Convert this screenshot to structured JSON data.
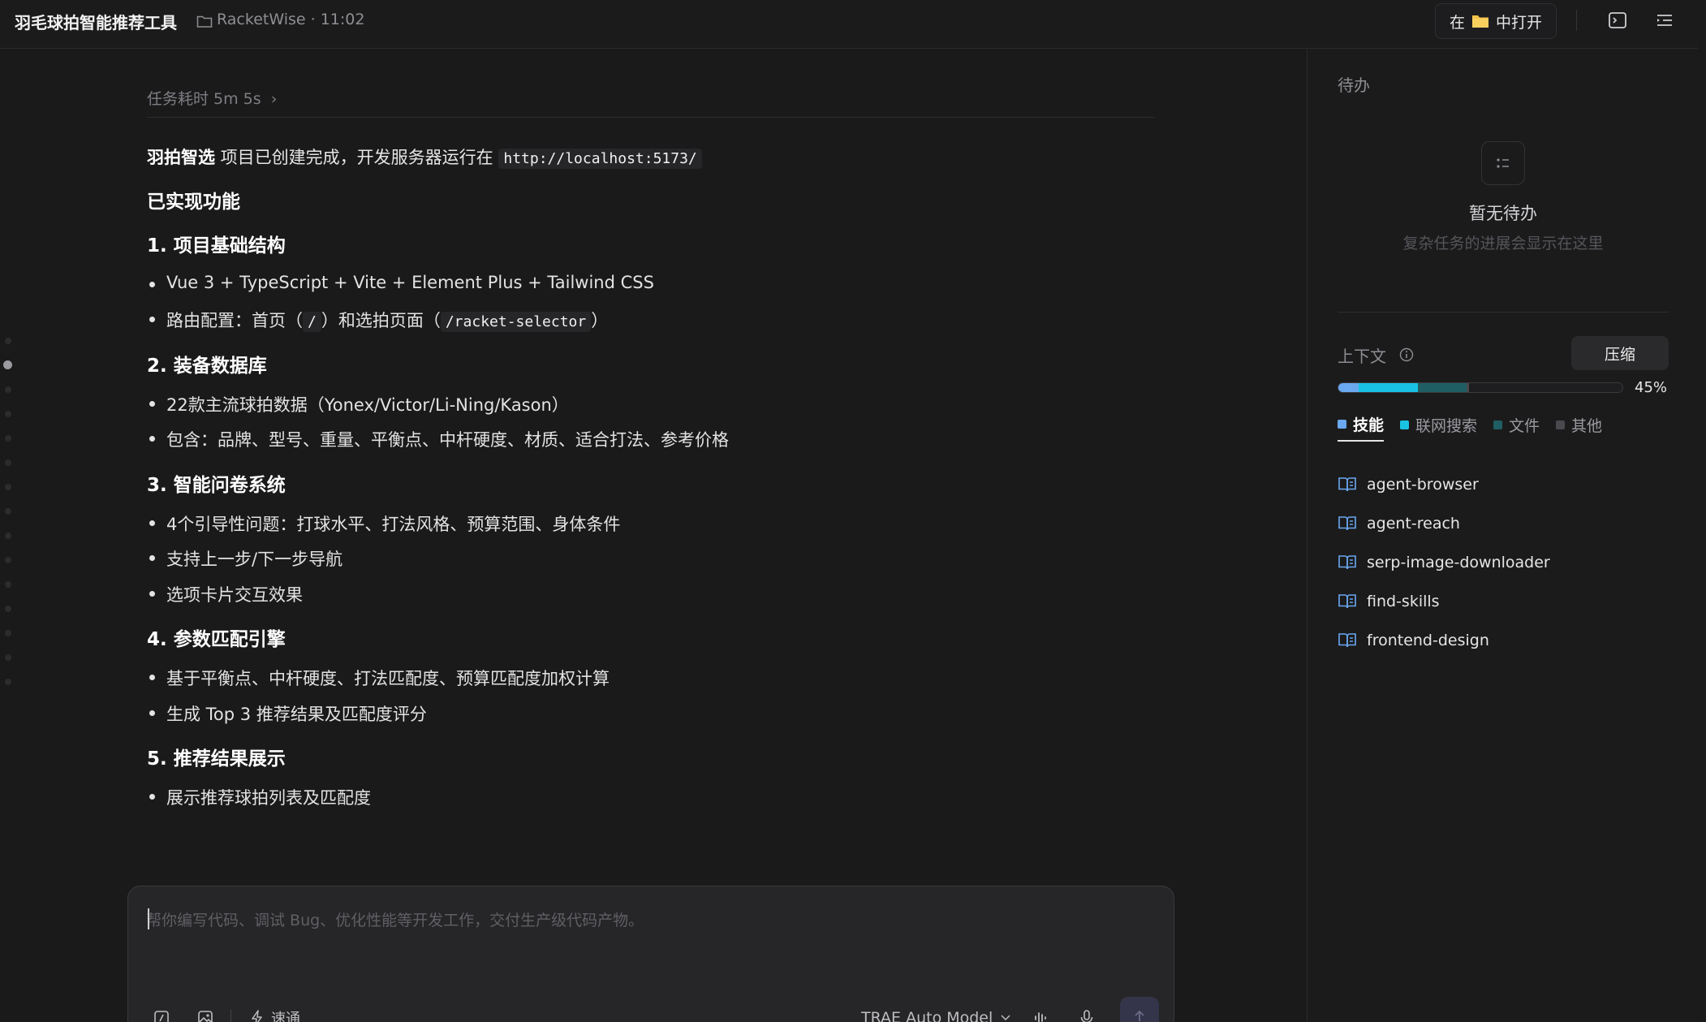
{
  "header": {
    "app_title": "羽毛球拍智能推荐工具",
    "project_meta": "RacketWise · 11:02",
    "open_in_prefix": "在",
    "open_in_suffix": "中打开"
  },
  "task": {
    "elapsed": "任务耗时 5m 5s"
  },
  "message": {
    "intro_bold": "羽拍智选",
    "intro_text": " 项目已创建完成，开发服务器运行在 ",
    "intro_url": "http://localhost:5173/",
    "features_heading": "已实现功能",
    "sections": [
      {
        "heading": "1. 项目基础结构",
        "bullets": [
          {
            "text": "Vue 3 + TypeScript + Vite + Element Plus + Tailwind CSS"
          },
          {
            "pre": "路由配置：首页（",
            "code1": "/",
            "mid": "）和选拍页面（",
            "code2": "/racket-selector",
            "post": "）"
          }
        ]
      },
      {
        "heading": "2. 装备数据库",
        "bullets": [
          {
            "text": "22款主流球拍数据（Yonex/Victor/Li-Ning/Kason）"
          },
          {
            "text": "包含：品牌、型号、重量、平衡点、中杆硬度、材质、适合打法、参考价格"
          }
        ]
      },
      {
        "heading": "3. 智能问卷系统",
        "bullets": [
          {
            "text": "4个引导性问题：打球水平、打法风格、预算范围、身体条件"
          },
          {
            "text": "支持上一步/下一步导航"
          },
          {
            "text": "选项卡片交互效果"
          }
        ]
      },
      {
        "heading": "4. 参数匹配引擎",
        "bullets": [
          {
            "text": "基于平衡点、中杆硬度、打法匹配度、预算匹配度加权计算"
          },
          {
            "text": "生成 Top 3 推荐结果及匹配度评分"
          }
        ]
      },
      {
        "heading": "5. 推荐结果展示",
        "bullets": [
          {
            "text": "展示推荐球拍列表及匹配度"
          }
        ]
      }
    ]
  },
  "composer": {
    "placeholder": "帮你编写代码、调试 Bug、优化性能等开发工作，交付生产级代码产物。",
    "mode_label": "速通",
    "model_label": "TRAE Auto Model"
  },
  "todo": {
    "title": "待办",
    "empty_title": "暂无待办",
    "empty_subtitle": "复杂任务的进展会显示在这里"
  },
  "context": {
    "title": "上下文",
    "compress_label": "压缩",
    "percent_label": "45%",
    "usage_fraction": 0.45,
    "segments": [
      {
        "name": "技能",
        "fraction": 0.07,
        "color": "#6aa8f0"
      },
      {
        "name": "联网搜索",
        "fraction": 0.21,
        "color": "#19c2e3"
      },
      {
        "name": "文件",
        "fraction": 0.17,
        "color": "#1f5e63"
      },
      {
        "name": "其他",
        "fraction": 0.01,
        "color": "#4a4a4e"
      }
    ],
    "legend": [
      {
        "label": "技能",
        "color": "#6aa8f0",
        "active": true
      },
      {
        "label": "联网搜索",
        "color": "#19c2e3",
        "active": false
      },
      {
        "label": "文件",
        "color": "#1f5e63",
        "active": false
      },
      {
        "label": "其他",
        "color": "#4a4a4e",
        "active": false
      }
    ],
    "skills": [
      "agent-browser",
      "agent-reach",
      "serp-image-downloader",
      "find-skills",
      "frontend-design"
    ]
  }
}
